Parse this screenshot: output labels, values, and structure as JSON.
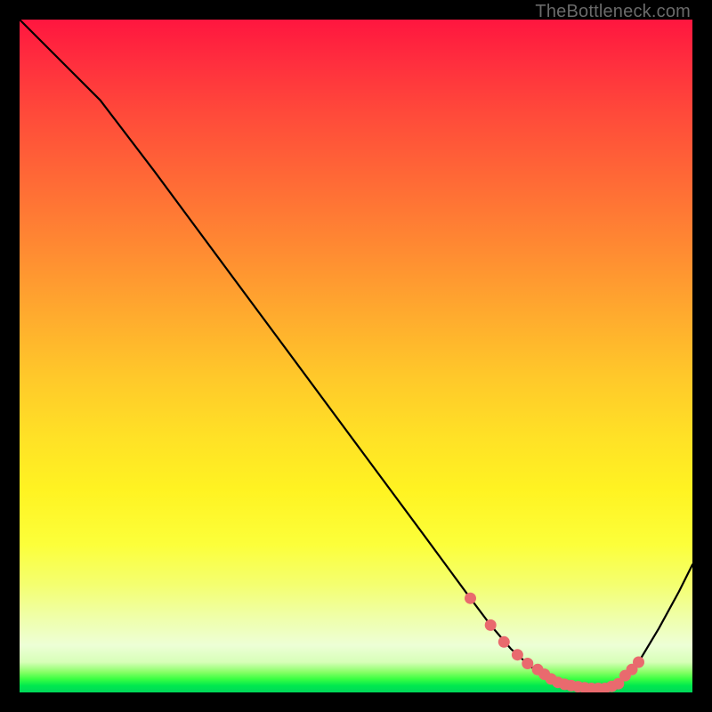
{
  "watermark": "TheBottleneck.com",
  "chart_data": {
    "type": "line",
    "title": "",
    "xlabel": "",
    "ylabel": "",
    "xlim": [
      0,
      100
    ],
    "ylim": [
      0,
      100
    ],
    "x": [
      0,
      8,
      12,
      20,
      30,
      40,
      50,
      60,
      67,
      70,
      73,
      76,
      79,
      82,
      85,
      87,
      89,
      92,
      95,
      98,
      100
    ],
    "values": [
      100,
      92,
      88,
      77.5,
      64,
      50.5,
      37,
      23.5,
      14,
      10,
      6.5,
      3.8,
      2.0,
      1.0,
      0.6,
      0.6,
      1.3,
      4.5,
      9.5,
      15,
      19
    ],
    "markers_x": [
      67,
      70,
      72,
      74,
      75.5,
      77,
      78,
      79,
      80,
      81,
      82,
      83,
      84,
      85,
      86,
      87,
      88,
      89,
      90,
      91,
      92
    ],
    "markers_y": [
      14,
      10,
      7.5,
      5.6,
      4.3,
      3.4,
      2.7,
      2.0,
      1.5,
      1.2,
      1.0,
      0.85,
      0.7,
      0.6,
      0.6,
      0.6,
      0.9,
      1.3,
      2.5,
      3.4,
      4.5
    ],
    "marker_color": "#e96a6e",
    "line_color": "#000000",
    "background": "gradient-red-yellow-green"
  }
}
